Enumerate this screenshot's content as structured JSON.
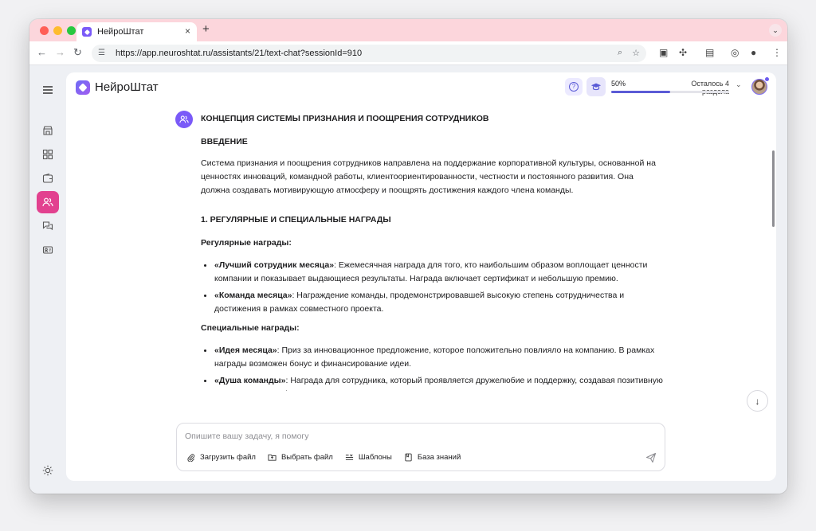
{
  "browser": {
    "tab_title": "НейроШтат",
    "tab_close": "×",
    "new_tab": "+",
    "tab_menu": "⌄",
    "url": "https://app.neuroshtat.ru/assistants/21/text-chat?sessionId=910"
  },
  "app": {
    "logo_text": "НейроШтат",
    "help_glyph": "?",
    "progress": {
      "percent_label": "50%",
      "value": 0.5,
      "remaining_label": "Осталось 4 раздела"
    }
  },
  "message": {
    "title": "КОНЦЕПЦИЯ СИСТЕМЫ ПРИЗНАНИЯ И ПООЩРЕНИЯ СОТРУДНИКОВ",
    "intro_heading": "ВВЕДЕНИЕ",
    "intro_text": "Система признания и поощрения сотрудников направлена на поддержание корпоративной культуры, основанной на ценностях инноваций, командной работы, клиентоориентированности, честности и постоянного развития. Она должна создавать мотивирующую атмосферу и поощрять достижения каждого члена команды.",
    "section1_heading": "1. РЕГУЛЯРНЫЕ И СПЕЦИАЛЬНЫЕ НАГРАДЫ",
    "regular_heading": "Регулярные награды:",
    "regular_items": [
      {
        "name": "«Лучший сотрудник месяца»",
        "text": ": Ежемесячная награда для того, кто наибольшим образом воплощает ценности компании и показывает выдающиеся результаты. Награда включает сертификат и небольшую премию."
      },
      {
        "name": "«Команда месяца»",
        "text": ": Награждение команды, продемонстрировавшей высокую степень сотрудничества и достижения в рамках совместного проекта."
      }
    ],
    "special_heading": "Специальные награды:",
    "special_items": [
      {
        "name": "«Идея месяца»",
        "text": ": Приз за инновационное предложение, которое положительно повлияло на компанию. В рамках награды возможен бонус и финансирование идеи."
      },
      {
        "name": "«Душа команды»",
        "text": ": Награда для сотрудника, который проявляется дружелюбие и поддержку, создавая позитивную командную атмосферу."
      }
    ]
  },
  "composer": {
    "placeholder": "Опишите вашу задачу, я помогу",
    "upload_label": "Загрузить файл",
    "choose_label": "Выбрать файл",
    "templates_label": "Шаблоны",
    "knowledge_label": "База знаний"
  },
  "colors": {
    "accent": "#5b5bd6",
    "active_nav": "#e2418f",
    "tab_strip": "#fcd6dc"
  }
}
